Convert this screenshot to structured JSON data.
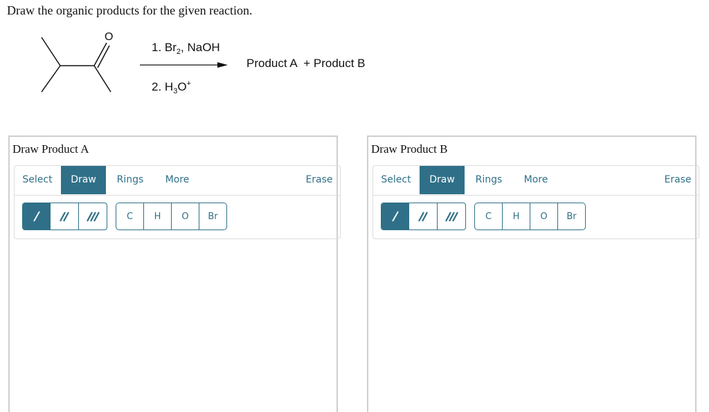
{
  "prompt": "Draw the organic products for the given reaction.",
  "reaction": {
    "reactant": "3-methyl-2-butanone",
    "reactant_atom_label": "O",
    "step1": {
      "prefix": "1. Br",
      "sub": "2",
      "suffix": ", NaOH"
    },
    "step2": {
      "prefix": "2. H",
      "sub": "3",
      "mid": "O",
      "sup": "+"
    },
    "products": "Product A  + Product B"
  },
  "panels": [
    {
      "title": "Draw Product A",
      "tabs": {
        "select": "Select",
        "draw": "Draw",
        "rings": "Rings",
        "more": "More",
        "erase": "Erase"
      },
      "active_tab": "Draw",
      "bonds": [
        "single-bond",
        "double-bond",
        "triple-bond"
      ],
      "active_bond": "single-bond",
      "atoms": [
        "C",
        "H",
        "O",
        "Br"
      ]
    },
    {
      "title": "Draw Product B",
      "tabs": {
        "select": "Select",
        "draw": "Draw",
        "rings": "Rings",
        "more": "More",
        "erase": "Erase"
      },
      "active_tab": "Draw",
      "bonds": [
        "single-bond",
        "double-bond",
        "triple-bond"
      ],
      "active_bond": "single-bond",
      "atoms": [
        "C",
        "H",
        "O",
        "Br"
      ]
    }
  ],
  "colors": {
    "accent": "#2f7088",
    "panel_border": "#cfcfcf",
    "toolbar_border": "#dcdcdc"
  }
}
